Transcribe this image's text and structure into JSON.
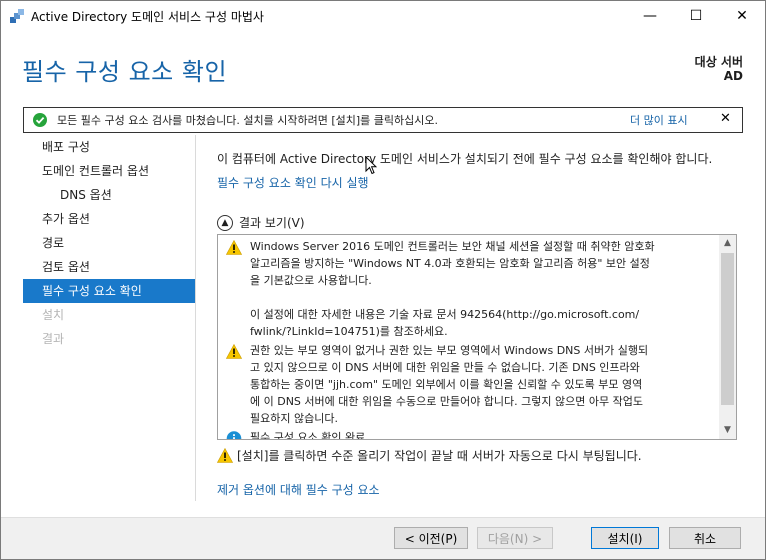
{
  "window": {
    "title": "Active Directory 도메인 서비스 구성 마법사",
    "minimize": "—",
    "maximize": "☐",
    "close": "✕"
  },
  "header": {
    "page_title": "필수 구성 요소 확인",
    "destination_label": "대상 서버",
    "destination_value": "AD"
  },
  "notification": {
    "message": "모든 필수 구성 요소 검사를 마쳤습니다. 설치를 시작하려면 [설치]를 클릭하십시오.",
    "more_link": "더 많이 표시",
    "close": "✕"
  },
  "sidebar": {
    "items": [
      {
        "label": "배포 구성"
      },
      {
        "label": "도메인 컨트롤러 옵션"
      },
      {
        "label": "DNS 옵션"
      },
      {
        "label": "추가 옵션"
      },
      {
        "label": "경로"
      },
      {
        "label": "검토 옵션"
      },
      {
        "label": "필수 구성 요소 확인"
      },
      {
        "label": "설치"
      },
      {
        "label": "결과"
      }
    ]
  },
  "main": {
    "intro": "이 컴퓨터에 Active Directory 도메인 서비스가 설치되기 전에 필수 구성 요소를 확인해야 합니다.",
    "rerun_link": "필수 구성 요소 확인 다시 실행",
    "results_toggle": "결과 보기(V)",
    "results": [
      {
        "icon": "warning-icon",
        "lines": [
          "Windows Server 2016 도메인 컨트롤러는 보안 채널 세션을 설정할 때 취약한 암호화",
          "알고리즘을 방지하는 \"Windows NT 4.0과 호환되는 암호화 알고리즘 허용\" 보안 설정",
          "을 기본값으로 사용합니다.",
          "",
          "이 설정에 대한 자세한 내용은 기술 자료 문서 942564(http://go.microsoft.com/",
          "fwlink/?LinkId=104751)를 참조하세요."
        ]
      },
      {
        "icon": "warning-icon",
        "lines": [
          "권한 있는 부모 영역이 없거나 권한 있는 부모 영역에서 Windows DNS 서버가 실행되",
          "고 있지 않으므로 이 DNS 서버에 대한 위임을 만들 수 없습니다. 기존 DNS 인프라와",
          "통합하는 중이면 \"jjh.com\" 도메인 외부에서 이를 확인을 신뢰할 수 있도록 부모 영역",
          "에 이 DNS 서버에 대한 위임을 수동으로 만들어야 합니다. 그렇지 않으면 아무 작업도",
          "필요하지 않습니다."
        ]
      },
      {
        "icon": "info-icon",
        "lines": [
          "필수 구성 요소 확인 완료"
        ]
      }
    ],
    "reboot_warning": "[설치]를 클릭하면 수준 올리기 작업이 끝날 때 서버가 자동으로 다시 부팅됩니다.",
    "more_link": "제거 옵션에 대해 필수 구성 요소"
  },
  "footer": {
    "prev": "< 이전(P)",
    "next": "다음(N) >",
    "install": "설치(I)",
    "cancel": "취소"
  },
  "colors": {
    "accent": "#1979ca",
    "link": "#1764a8",
    "warning": "#f7c600",
    "info": "#1b8fd4",
    "success": "#26a43b"
  }
}
